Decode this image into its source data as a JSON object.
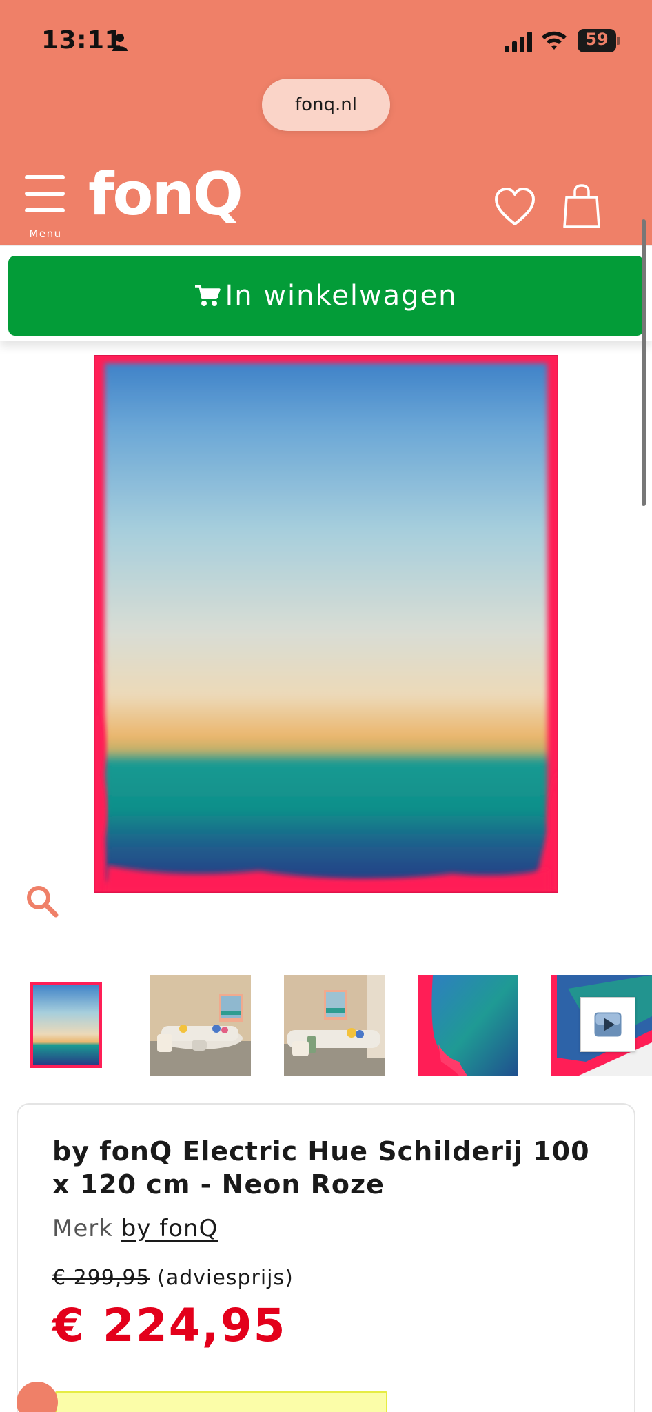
{
  "status_bar": {
    "time": "13:11",
    "battery": "59"
  },
  "browser": {
    "url": "fonq.nl"
  },
  "header": {
    "menu_label": "Menu",
    "logo": "fonQ",
    "icons": [
      "menu-icon",
      "heart-icon",
      "shopping-bag-icon"
    ]
  },
  "sticky_bar": {
    "add_to_cart_label": "In winkelwagen",
    "icon": "cart-icon"
  },
  "gallery": {
    "thumbnails": [
      "painting-front",
      "living-room-view-1",
      "living-room-view-2",
      "detail-closeup",
      "video-thumbnail"
    ],
    "zoom_icon": "search-icon",
    "play_icon": "play-icon"
  },
  "product": {
    "title": "by fonQ Electric Hue Schilderij 100 x 120 cm - Neon Roze",
    "brand_label": "Merk",
    "brand_name": "by fonQ",
    "old_price": "€ 299,95",
    "old_price_note": "(adviesprijs)",
    "price": "€ 224,95"
  },
  "colors": {
    "header_bg": "#ef8068",
    "cart_button": "#039c38",
    "price_red": "#e3001b",
    "frame_neon_pink": "#ff1e56"
  }
}
